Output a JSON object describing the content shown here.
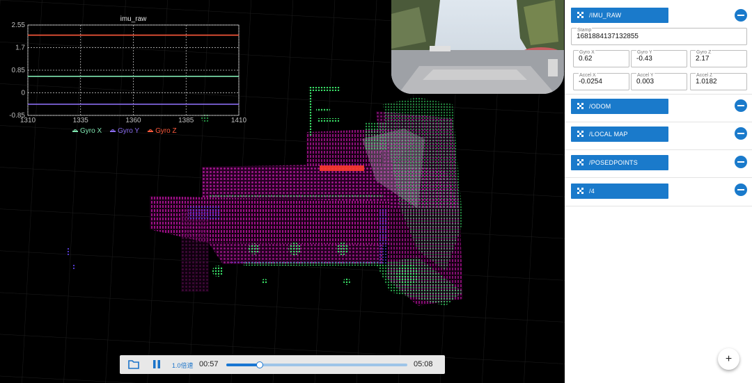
{
  "chart_data": {
    "type": "line",
    "title": "imu_raw",
    "x": [
      1310,
      1335,
      1360,
      1385,
      1410
    ],
    "xticks": [
      "1310",
      "1335",
      "1360",
      "1385",
      "1410"
    ],
    "yticks": [
      "2.55",
      "1.7",
      "0.85",
      "0",
      "-0.85"
    ],
    "ylim": [
      -0.85,
      2.55
    ],
    "xlim": [
      1310,
      1410
    ],
    "grid": true,
    "legend_position": "bottom",
    "series": [
      {
        "name": "Gyro X",
        "color": "#7fe6b0",
        "values": [
          0.62,
          0.62,
          0.62,
          0.62,
          0.62
        ]
      },
      {
        "name": "Gyro Y",
        "color": "#8a6cf0",
        "values": [
          -0.43,
          -0.43,
          -0.43,
          -0.43,
          -0.43
        ]
      },
      {
        "name": "Gyro Z",
        "color": "#ff5a3c",
        "values": [
          2.17,
          2.17,
          2.17,
          2.17,
          2.17
        ]
      }
    ]
  },
  "player": {
    "speed": "1.0倍速",
    "current_time": "00:57",
    "total_time": "05:08",
    "progress": 0.185
  },
  "topics": [
    {
      "label": "/IMU_RAW"
    },
    {
      "label": "/ODOM"
    },
    {
      "label": "/LOCAL MAP"
    },
    {
      "label": "/POSEDPOINTS"
    },
    {
      "label": "/4"
    }
  ],
  "imu": {
    "stamp_label": "Stamp",
    "stamp_value": "1681884137132855",
    "gyro_x_label": "Gyro X",
    "gyro_x_value": "0.62",
    "gyro_y_label": "Gyro Y",
    "gyro_y_value": "-0.43",
    "gyro_z_label": "Gyro Z",
    "gyro_z_value": "2.17",
    "accel_x_label": "Accel X",
    "accel_x_value": "-0.0254",
    "accel_y_label": "Accel Y",
    "accel_y_value": "0.003",
    "accel_z_label": "Accel Z",
    "accel_z_value": "1.0182"
  },
  "fab_label": "+",
  "colors": {
    "accent": "#1a7acb",
    "points_magenta": "#b0139a",
    "points_green": "#39e36a",
    "points_blue": "#4b3bd8"
  }
}
